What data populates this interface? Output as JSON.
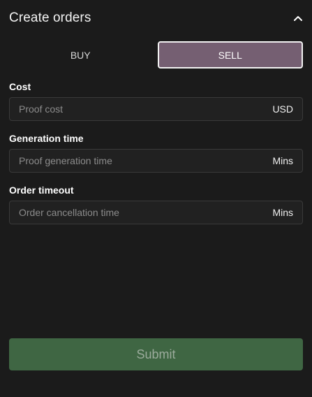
{
  "header": {
    "title": "Create orders",
    "collapse_icon": "chevron-up-icon"
  },
  "tabs": [
    {
      "label": "BUY",
      "selected": false
    },
    {
      "label": "SELL",
      "selected": true
    }
  ],
  "fields": {
    "cost": {
      "label": "Cost",
      "placeholder": "Proof cost",
      "value": "",
      "unit": "USD"
    },
    "generation_time": {
      "label": "Generation time",
      "placeholder": "Proof generation time",
      "value": "",
      "unit": "Mins"
    },
    "order_timeout": {
      "label": "Order timeout",
      "placeholder": "Order cancellation time",
      "value": "",
      "unit": "Mins"
    }
  },
  "submit": {
    "label": "Submit"
  },
  "colors": {
    "background": "#1b1b1b",
    "sell_tab": "#755f72",
    "submit": "#3f6643"
  }
}
